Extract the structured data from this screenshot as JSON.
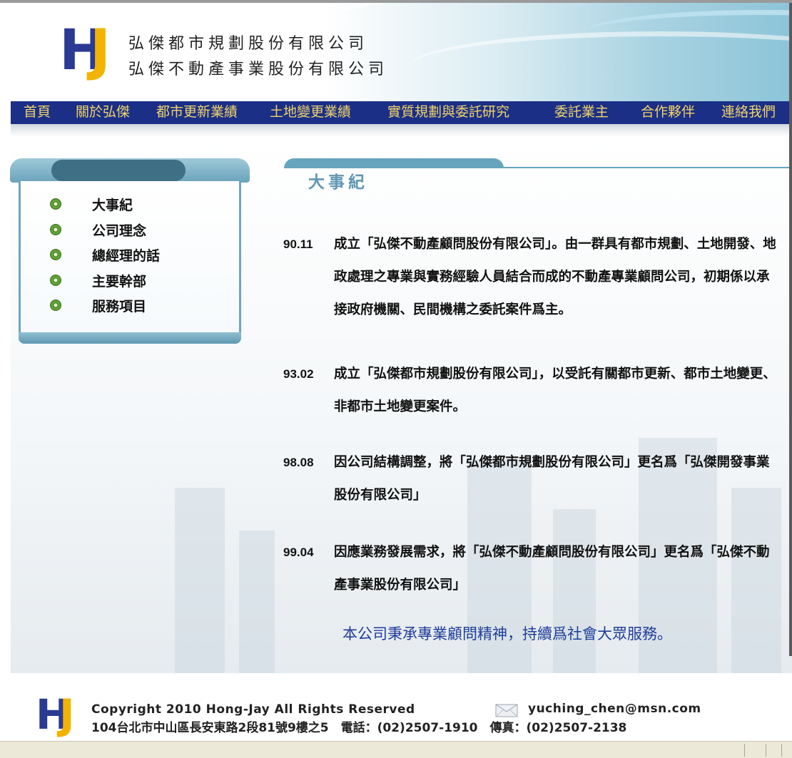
{
  "company": {
    "name_line1": "弘傑都市規劃股份有限公司",
    "name_line2": "弘傑不動產事業股份有限公司",
    "logo_letters": {
      "h": "H",
      "j": "J"
    },
    "brand_colors": {
      "navy": "#2b3a92",
      "gold": "#f2b400"
    }
  },
  "nav": {
    "items": [
      {
        "label": "首頁"
      },
      {
        "label": "關於弘傑"
      },
      {
        "label": "都市更新業績"
      },
      {
        "label": "土地變更業績"
      },
      {
        "label": "實質規劃與委託研究"
      },
      {
        "label": "委託業主"
      },
      {
        "label": "合作夥伴"
      },
      {
        "label": "連絡我們"
      }
    ],
    "bg_color": "#1b2f86",
    "text_color": "#f0d36a"
  },
  "sidebar": {
    "items": [
      {
        "label": "大事紀",
        "icon": "green-bullet-icon"
      },
      {
        "label": "公司理念",
        "icon": "green-bullet-icon"
      },
      {
        "label": "總經理的話",
        "icon": "green-bullet-icon"
      },
      {
        "label": "主要幹部",
        "icon": "green-bullet-icon"
      },
      {
        "label": "服務項目",
        "icon": "green-bullet-icon"
      }
    ]
  },
  "main": {
    "title": "大事紀",
    "events": [
      {
        "date": "90.11",
        "text": "成立「弘傑不動產顧問股份有限公司」。由一群具有都市規劃、土地開發、地政處理之專業與實務經驗人員結合而成的不動產專業顧問公司，初期係以承接政府機關、民間機構之委託案件爲主。"
      },
      {
        "date": "93.02",
        "text": "成立「弘傑都市規劃股份有限公司」，以受託有關都市更新、都市土地變更、非都市土地變更案件。"
      },
      {
        "date": "98.08",
        "text": "因公司結構調整，將「弘傑都市規劃股份有限公司」更名爲「弘傑開發事業股份有限公司」"
      },
      {
        "date": "99.04",
        "text": "因應業務發展需求，將「弘傑不動產顧問股份有限公司」更名爲「弘傑不動產事業股份有限公司」"
      }
    ],
    "motto": "本公司秉承專業顧問精神，持續爲社會大眾服務。"
  },
  "footer": {
    "copyright": "Copyright 2010 Hong-Jay All Rights Reserved",
    "email": "yuching_chen@msn.com",
    "address": "104台北市中山區長安東路2段81號9樓之5　電話：(02)2507-1910　傳真：(02)2507-2138",
    "mail_icon": "envelope-icon"
  }
}
